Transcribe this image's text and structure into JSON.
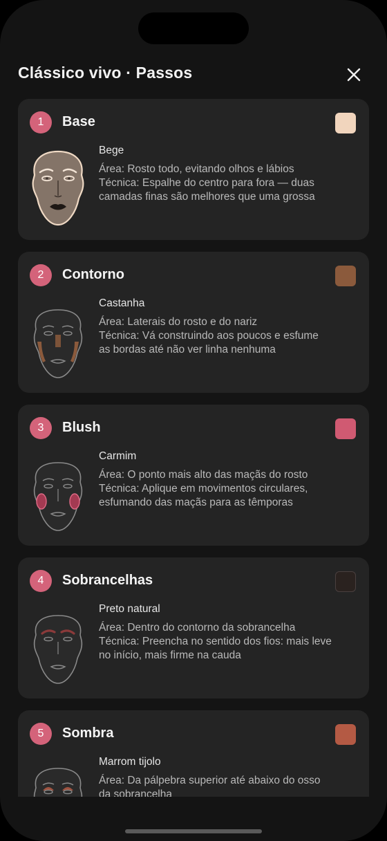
{
  "header": {
    "title": "Clássico vivo · Passos"
  },
  "steps": [
    {
      "number": "1",
      "title": "Base",
      "swatch_color": "#f1d5bd",
      "color_name": "Bege",
      "area_line": "Área: Rosto todo, evitando olhos e lábios",
      "technique_line1": "Técnica: Espalhe do centro para fora — duas",
      "technique_line2": "camadas finas são melhores que uma grossa"
    },
    {
      "number": "2",
      "title": "Contorno",
      "swatch_color": "#8b5a3c",
      "color_name": "Castanha",
      "area_line": "Área: Laterais do rosto e do nariz",
      "technique_line1": "Técnica: Vá construindo aos poucos e esfume",
      "technique_line2": "as bordas até não ver linha nenhuma"
    },
    {
      "number": "3",
      "title": "Blush",
      "swatch_color": "#d05a72",
      "color_name": "Carmim",
      "area_line": "Área: O ponto mais alto das maçãs do rosto",
      "technique_line1": "Técnica: Aplique em movimentos circulares,",
      "technique_line2": "esfumando das maçãs para as têmporas"
    },
    {
      "number": "4",
      "title": "Sobrancelhas",
      "swatch_color": "#2a221f",
      "color_name": "Preto natural",
      "area_line": "Área: Dentro do contorno da sobrancelha",
      "technique_line1": "Técnica: Preencha no sentido dos fios: mais leve",
      "technique_line2": "no início, mais firme na cauda"
    },
    {
      "number": "5",
      "title": "Sombra",
      "swatch_color": "#b45a44",
      "color_name": "Marrom tijolo",
      "area_line": "Área: Da pálpebra superior até abaixo do osso",
      "technique_line1": "da sobrancelha",
      "technique_line2": ""
    }
  ],
  "colors": {
    "background": "#141414",
    "card": "#242424",
    "accent": "#d4637a"
  }
}
